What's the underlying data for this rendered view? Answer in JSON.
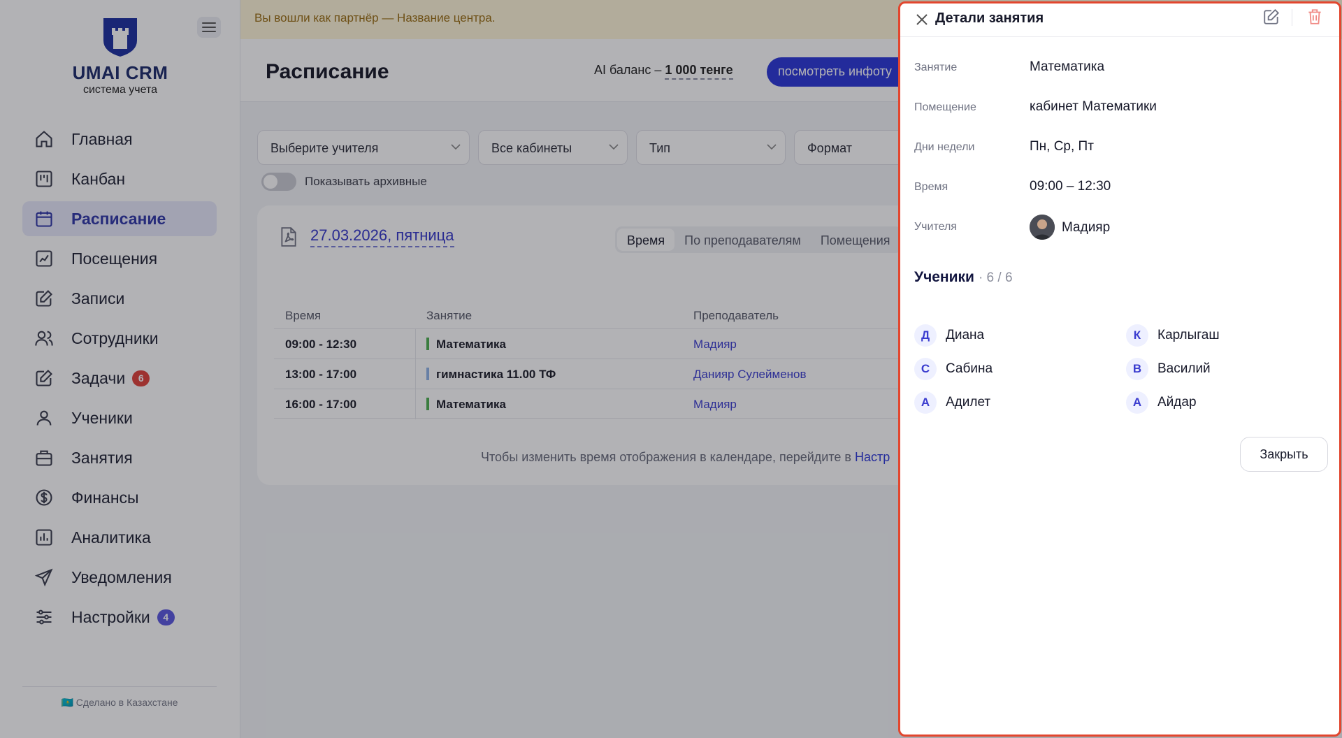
{
  "banner": {
    "text": "Вы вошли как партнёр — Название центра."
  },
  "logo": {
    "title": "UMAI CRM",
    "subtitle": "система учета"
  },
  "sidebar": {
    "items": [
      {
        "label": "Главная",
        "icon": "home-icon"
      },
      {
        "label": "Канбан",
        "icon": "kanban-icon"
      },
      {
        "label": "Расписание",
        "icon": "calendar-icon",
        "active": true
      },
      {
        "label": "Посещения",
        "icon": "attendance-icon"
      },
      {
        "label": "Записи",
        "icon": "edit-note-icon"
      },
      {
        "label": "Сотрудники",
        "icon": "users-icon"
      },
      {
        "label": "Задачи",
        "icon": "tasks-icon",
        "badge": "6"
      },
      {
        "label": "Ученики",
        "icon": "user-icon"
      },
      {
        "label": "Занятия",
        "icon": "briefcase-icon"
      },
      {
        "label": "Финансы",
        "icon": "dollar-icon"
      },
      {
        "label": "Аналитика",
        "icon": "chart-icon"
      },
      {
        "label": "Уведомления",
        "icon": "send-icon"
      },
      {
        "label": "Настройки",
        "icon": "sliders-icon",
        "badge": "4"
      }
    ],
    "footer": "🇰🇿 Сделано в Казахстане"
  },
  "header": {
    "title": "Расписание",
    "balance_label": "AI баланс –",
    "balance_value": "1 000 тенге",
    "info_button": "посмотреть инфоту"
  },
  "filters": {
    "teacher": "Выберите учителя",
    "rooms": "Все кабинеты",
    "type": "Тип",
    "format": "Формат",
    "archive_toggle": "Показывать архивные"
  },
  "schedule": {
    "date": "27.03.2026, пятница",
    "tabs": [
      "Время",
      "По преподавателям",
      "Помещения"
    ],
    "columns": [
      "Время",
      "Занятие",
      "Преподаватель"
    ],
    "rows": [
      {
        "time": "09:00 - 12:30",
        "lesson": "Математика",
        "teacher": "Мадияр",
        "color": "#4caf50"
      },
      {
        "time": "13:00 - 17:00",
        "lesson": "гимнастика 11.00 ТФ",
        "teacher": "Данияр Сулейменов",
        "color": "#8fb4e8"
      },
      {
        "time": "16:00 - 17:00",
        "lesson": "Математика",
        "teacher": "Мадияр",
        "color": "#4caf50"
      }
    ],
    "hint": "Чтобы изменить время отображения в календаре, перейдите в ",
    "hint_link": "Настр"
  },
  "drawer": {
    "title": "Детали занятия",
    "fields": {
      "lesson_label": "Занятие",
      "lesson_value": "Математика",
      "room_label": "Помещение",
      "room_value": "кабинет Математики",
      "days_label": "Дни недели",
      "days_value": "Пн, Ср, Пт",
      "time_label": "Время",
      "time_value": "09:00 – 12:30",
      "teachers_label": "Учителя",
      "teacher_name": "Мадияр"
    },
    "students_title": "Ученики",
    "students_count": "· 6 / 6",
    "students": [
      {
        "initial": "Д",
        "name": "Диана"
      },
      {
        "initial": "К",
        "name": "Карлыгаш"
      },
      {
        "initial": "С",
        "name": "Сабина"
      },
      {
        "initial": "В",
        "name": "Василий"
      },
      {
        "initial": "А",
        "name": "Адилет"
      },
      {
        "initial": "А",
        "name": "Айдар"
      }
    ],
    "close_button": "Закрыть"
  },
  "colors": {
    "accent": "#2b36d8",
    "drawer_border": "#e2462e",
    "active_nav": "#2f37a8"
  }
}
